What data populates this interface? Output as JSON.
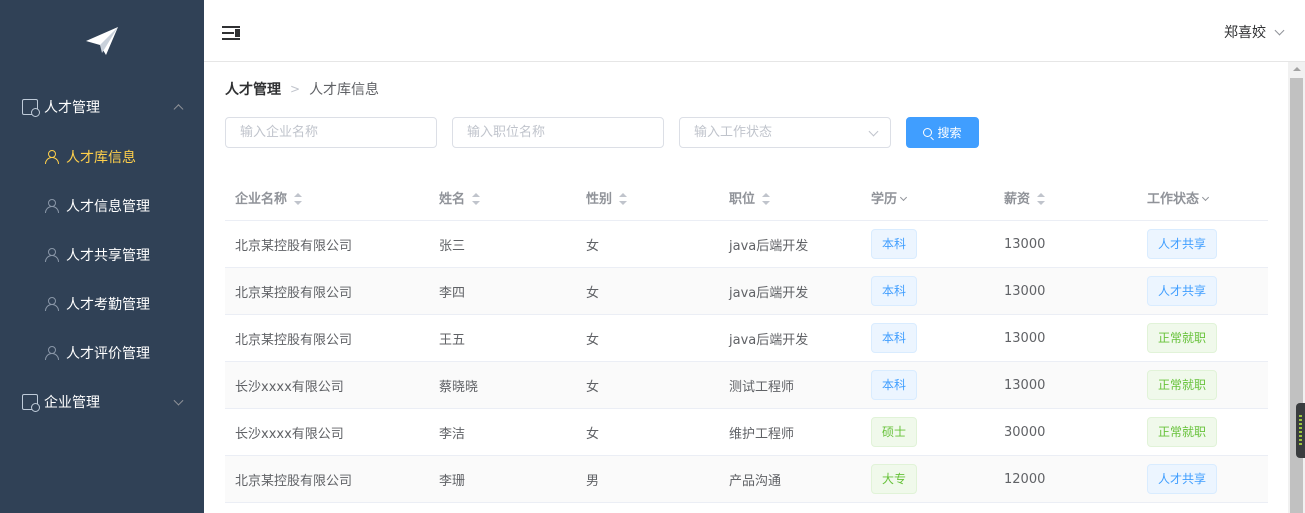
{
  "header": {
    "user_name": "郑喜姣"
  },
  "sidebar": {
    "groups": [
      {
        "label": "人才管理",
        "expanded": true,
        "items": [
          {
            "label": "人才库信息",
            "active": true
          },
          {
            "label": "人才信息管理",
            "active": false
          },
          {
            "label": "人才共享管理",
            "active": false
          },
          {
            "label": "人才考勤管理",
            "active": false
          },
          {
            "label": "人才评价管理",
            "active": false
          }
        ]
      },
      {
        "label": "企业管理",
        "expanded": false
      }
    ]
  },
  "breadcrumb": {
    "parent": "人才管理",
    "current": "人才库信息"
  },
  "filters": {
    "company_placeholder": "输入企业名称",
    "position_placeholder": "输入职位名称",
    "status_placeholder": "输入工作状态",
    "search_label": "搜索"
  },
  "table": {
    "columns": [
      "企业名称",
      "姓名",
      "性别",
      "职位",
      "学历",
      "薪资",
      "工作状态"
    ],
    "rows": [
      [
        "北京某控股有限公司",
        "张三",
        "女",
        "java后端开发",
        "本科",
        "13000",
        "人才共享"
      ],
      [
        "北京某控股有限公司",
        "李四",
        "女",
        "java后端开发",
        "本科",
        "13000",
        "人才共享"
      ],
      [
        "北京某控股有限公司",
        "王五",
        "女",
        "java后端开发",
        "本科",
        "13000",
        "正常就职"
      ],
      [
        "长沙xxxx有限公司",
        "蔡晓晓",
        "女",
        "测试工程师",
        "本科",
        "13000",
        "正常就职"
      ],
      [
        "长沙xxxx有限公司",
        "李洁",
        "女",
        "维护工程师",
        "硕士",
        "30000",
        "正常就职"
      ],
      [
        "北京某控股有限公司",
        "李珊",
        "男",
        "产品沟通",
        "大专",
        "12000",
        "人才共享"
      ]
    ]
  },
  "colors": {
    "sidebar_bg": "#304156",
    "active_menu": "#ffd04b",
    "primary": "#409eff",
    "success": "#67c23a"
  }
}
